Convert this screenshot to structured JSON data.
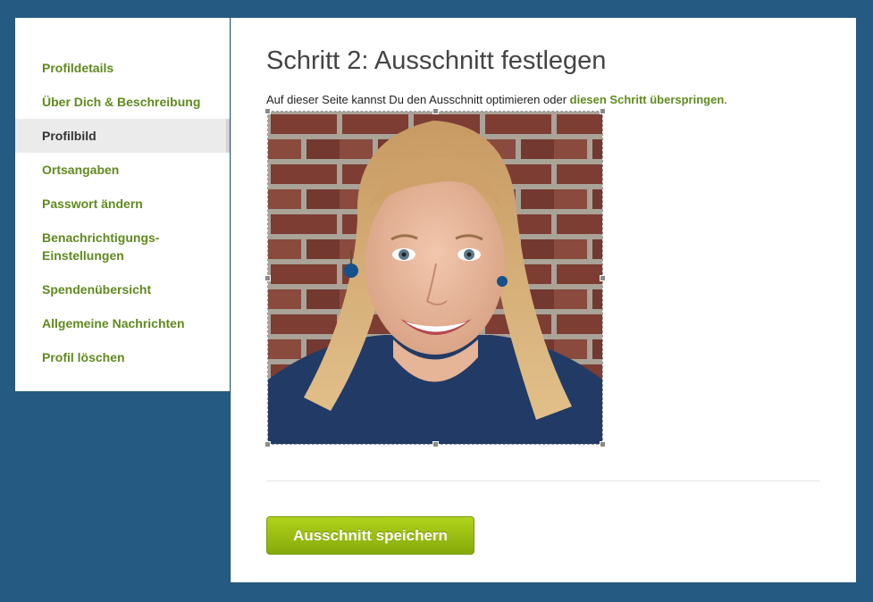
{
  "sidebar": {
    "items": [
      {
        "label": "Profildetails"
      },
      {
        "label": "Über Dich & Beschreibung"
      },
      {
        "label": "Profilbild",
        "active": true
      },
      {
        "label": "Ortsangaben"
      },
      {
        "label": "Passwort ändern"
      },
      {
        "label": "Benachrichtigungs-\nEinstellungen"
      },
      {
        "label": "Spendenübersicht"
      },
      {
        "label": "Allgemeine Nachrichten"
      },
      {
        "label": "Profil löschen"
      }
    ]
  },
  "main": {
    "title": "Schritt 2: Ausschnitt festlegen",
    "intro_prefix": "Auf dieser Seite kannst Du den Ausschnitt optimieren oder ",
    "skip_link": "diesen Schritt überspringen",
    "intro_suffix": ".",
    "save_button": "Ausschnitt speichern"
  },
  "colors": {
    "background": "#255a83",
    "link_green": "#5f8a1e",
    "button_green": "#9cc012"
  }
}
